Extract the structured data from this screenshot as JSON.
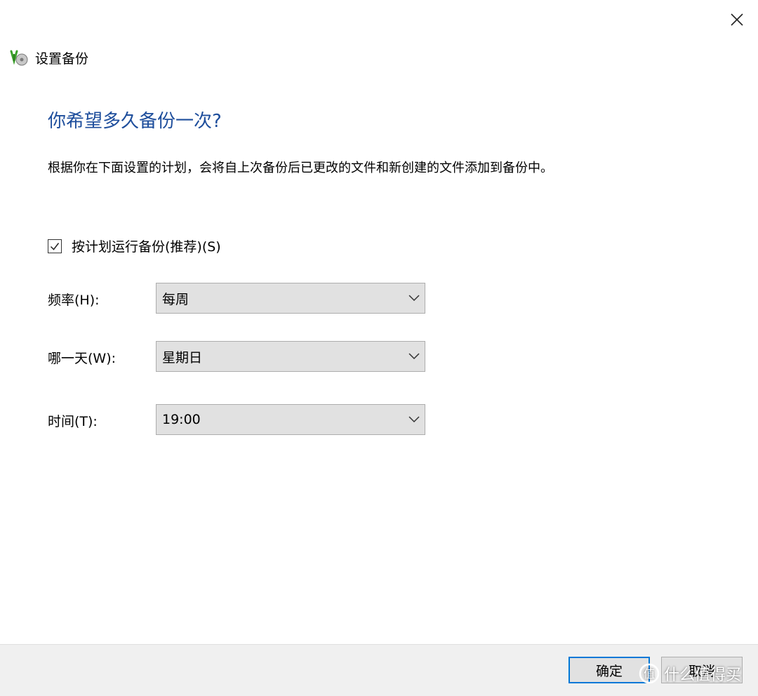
{
  "window": {
    "title": "设置备份",
    "close_glyph": "✕"
  },
  "main": {
    "heading": "你希望多久备份一次?",
    "description": "根据你在下面设置的计划，会将自上次备份后已更改的文件和新创建的文件添加到备份中。",
    "schedule_checkbox": {
      "label": "按计划运行备份(推荐)(S)",
      "checked": true
    },
    "fields": {
      "frequency": {
        "label": "频率(H):",
        "value": "每周"
      },
      "day": {
        "label": "哪一天(W):",
        "value": "星期日"
      },
      "time": {
        "label": "时间(T):",
        "value": "19:00"
      }
    }
  },
  "footer": {
    "ok_label": "确定",
    "cancel_label": "取消"
  },
  "watermark": {
    "text": "什么值得买"
  },
  "colors": {
    "heading": "#1e4e9c",
    "accent": "#0078d7",
    "footer_bg": "#f0f0f0",
    "control_bg": "#e1e1e1"
  },
  "icons": {
    "close": "close-icon",
    "app": "backup-app-icon",
    "check": "check-icon",
    "dropdown": "chevron-down-icon"
  }
}
